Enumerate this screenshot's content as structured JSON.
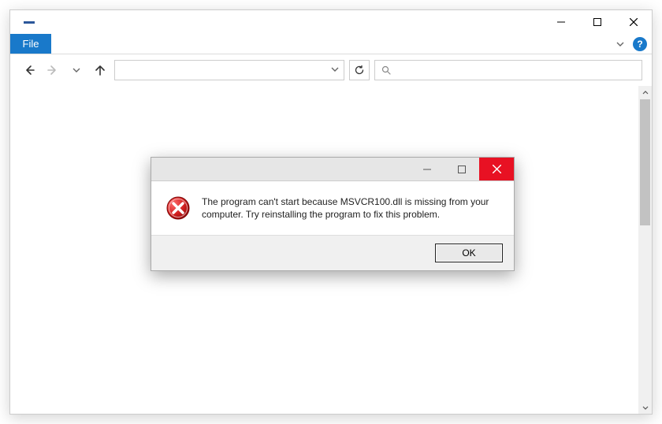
{
  "ribbon": {
    "file_label": "File",
    "help_label": "?"
  },
  "search": {
    "placeholder": ""
  },
  "dialog": {
    "message": "The program can't start because MSVCR100.dll is missing from your computer. Try reinstalling the program to fix this problem.",
    "ok_label": "OK"
  }
}
